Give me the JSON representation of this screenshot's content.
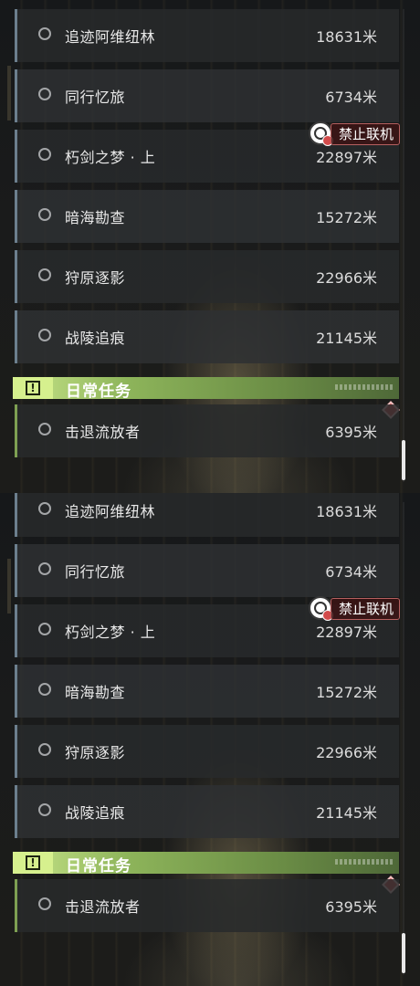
{
  "panels": [
    {
      "quests": [
        {
          "name": "追迹阿维纽林",
          "distance": "18631米"
        },
        {
          "name": "同行忆旅",
          "distance": "6734米"
        },
        {
          "name": "朽剑之梦 · 上",
          "distance": "22897米"
        },
        {
          "name": "暗海勘查",
          "distance": "15272米"
        },
        {
          "name": "狩原逐影",
          "distance": "22966米"
        },
        {
          "name": "战陵追痕",
          "distance": "21145米"
        }
      ],
      "ban_badge": "禁止联机",
      "section_title": "日常任务",
      "daily_quests": [
        {
          "name": "击退流放者",
          "distance": "6395米"
        }
      ]
    },
    {
      "quests": [
        {
          "name": "追迹阿维纽林",
          "distance": "18631米"
        },
        {
          "name": "同行忆旅",
          "distance": "6734米"
        },
        {
          "name": "朽剑之梦 · 上",
          "distance": "22897米"
        },
        {
          "name": "暗海勘查",
          "distance": "15272米"
        },
        {
          "name": "狩原逐影",
          "distance": "22966米"
        },
        {
          "name": "战陵追痕",
          "distance": "21145米"
        }
      ],
      "ban_badge": "禁止联机",
      "section_title": "日常任务",
      "daily_quests": [
        {
          "name": "击退流放者",
          "distance": "6395米"
        }
      ]
    }
  ],
  "colors": {
    "accent_blue": "#6c7f8e",
    "daily_green": "#8db45a",
    "ban_red": "#d24b4b"
  }
}
